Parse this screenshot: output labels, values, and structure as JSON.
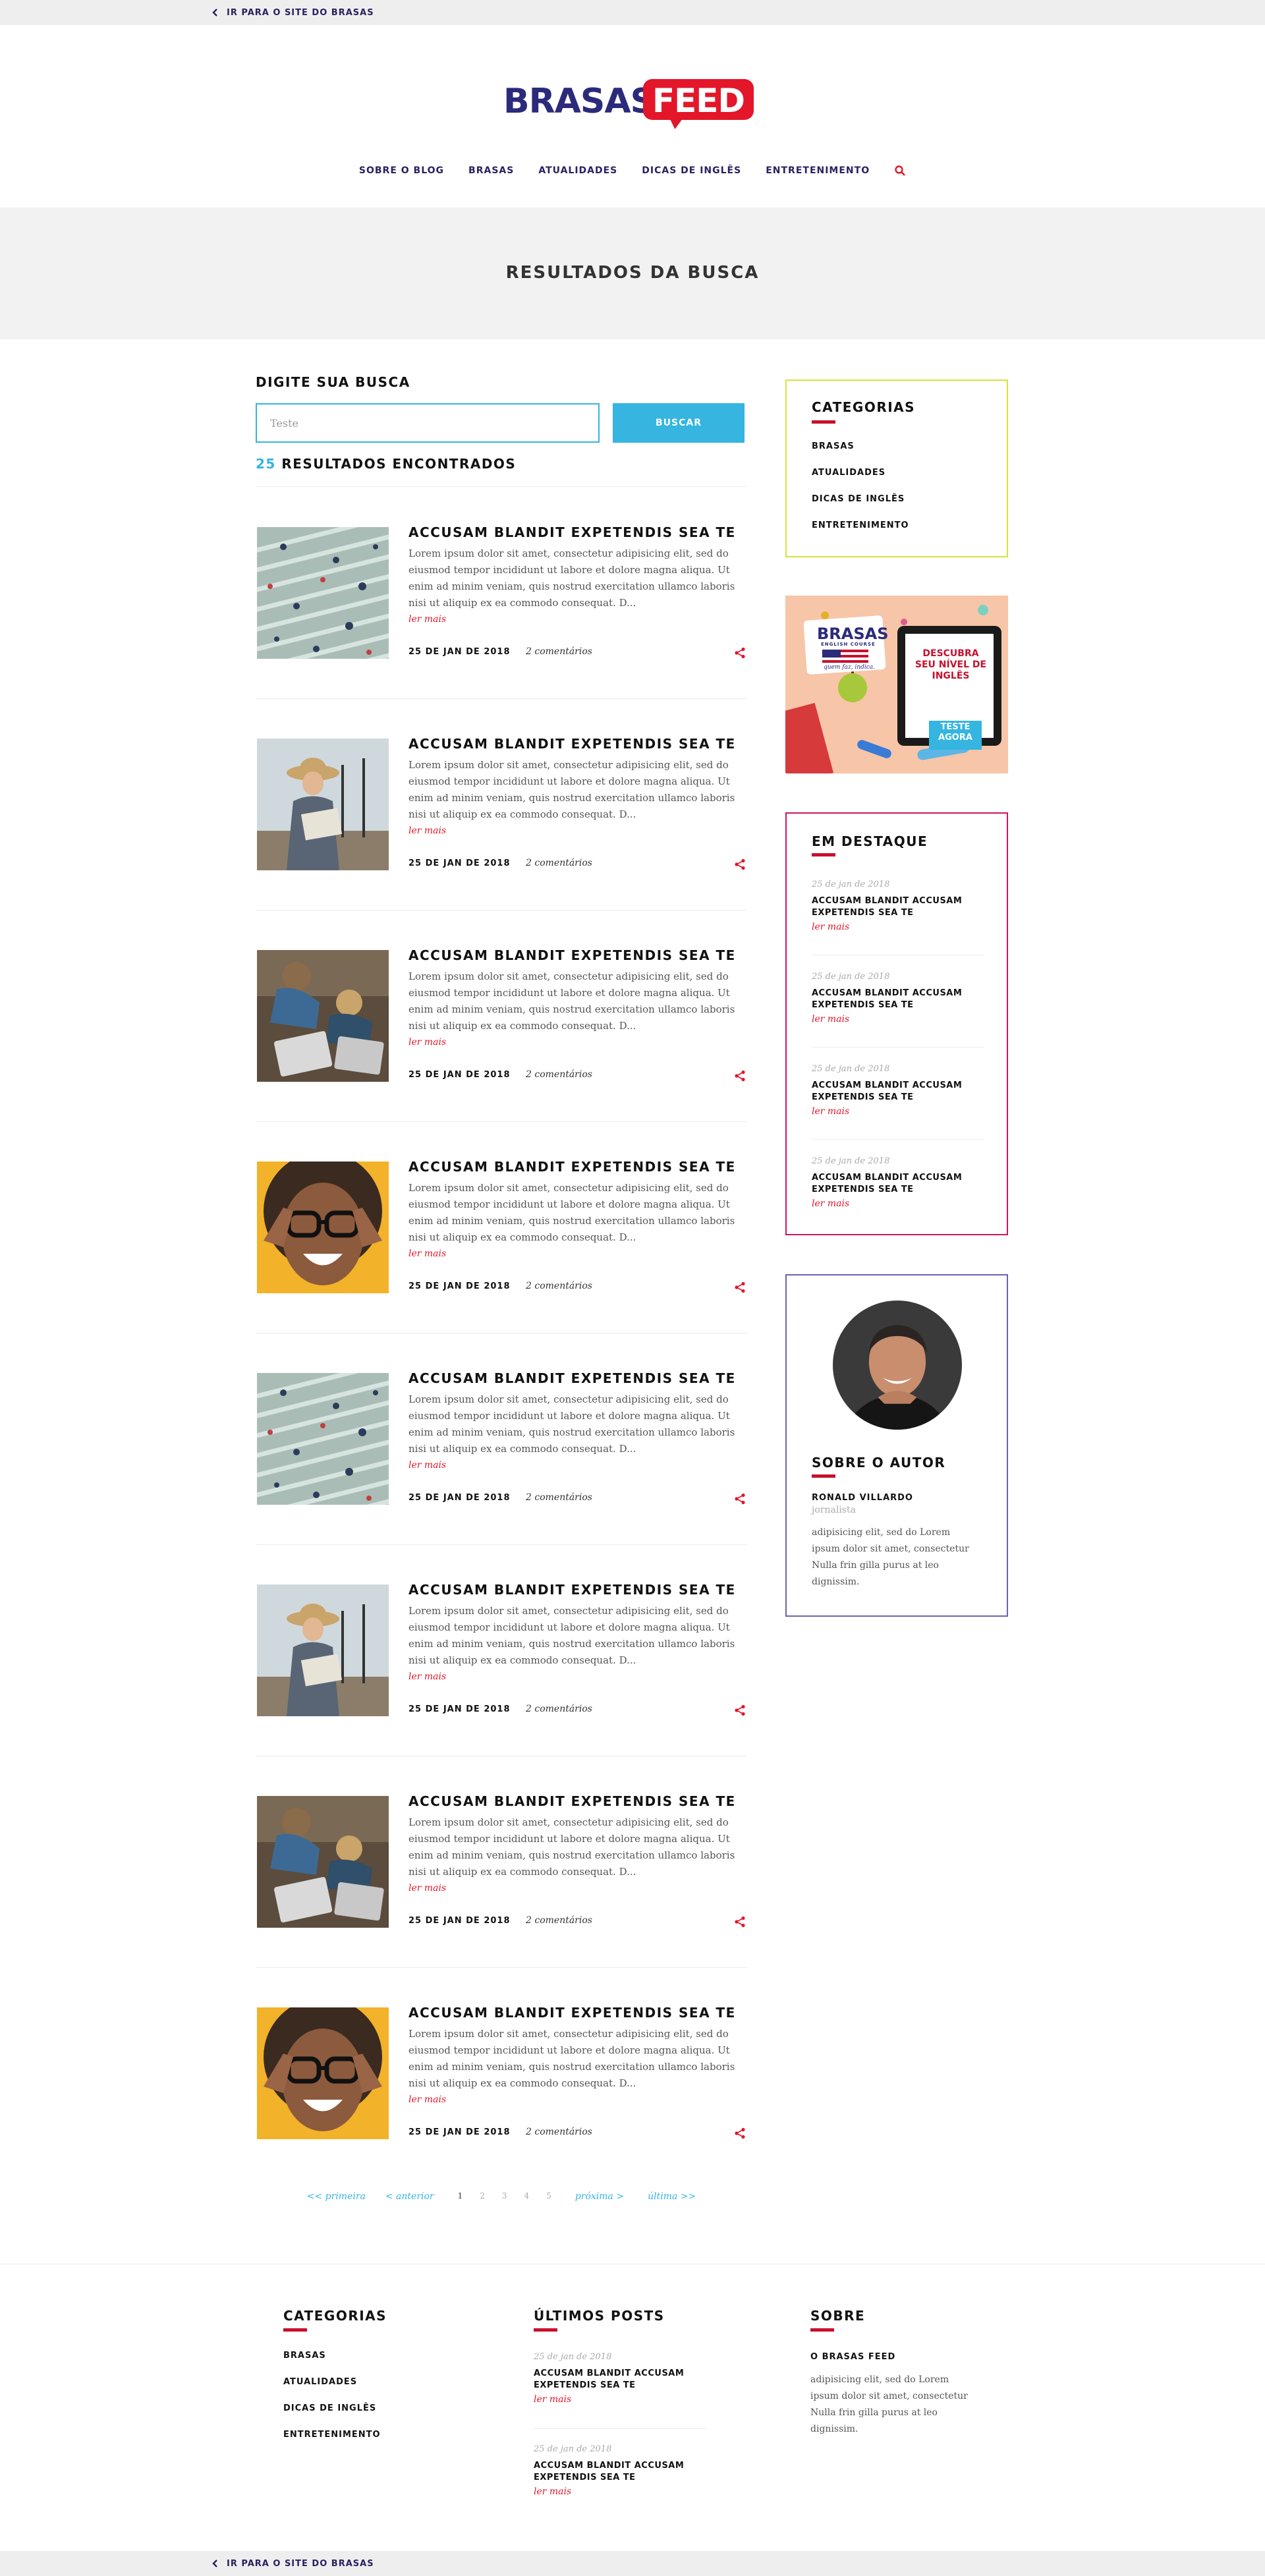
{
  "topbar": {
    "back_label": "IR PARA O SITE DO BRASAS"
  },
  "logo": {
    "left": "BRASAS",
    "right": "FEED"
  },
  "nav": {
    "items": [
      "SOBRE O BLOG",
      "BRASAS",
      "ATUALIDADES",
      "DICAS DE INGLÊS",
      "ENTRETENIMENTO"
    ],
    "search_icon": "search-icon"
  },
  "page_title": "RESULTADOS DA BUSCA",
  "search": {
    "label": "DIGITE SUA BUSCA",
    "value": "Teste",
    "button": "BUSCAR",
    "results_count": "25",
    "results_label": "RESULTADOS ENCONTRADOS"
  },
  "articles": [
    {
      "title": "ACCUSAM BLANDIT EXPETENDIS SEA TE",
      "excerpt": "Lorem ipsum dolor sit amet, consectetur adipisicing elit, sed do eiusmod tempor incididunt ut labore et dolore magna aliqua. Ut enim ad minim veniam, quis nostrud exercitation ullamco laboris nisi ut aliquip ex ea commodo consequat. D...",
      "more": "ler mais",
      "date": "25 DE JAN DE 2018",
      "comments": "2 comentários",
      "image": "crosswalk"
    },
    {
      "title": "ACCUSAM BLANDIT EXPETENDIS SEA TE",
      "excerpt": "Lorem ipsum dolor sit amet, consectetur adipisicing elit, sed do eiusmod tempor incididunt ut labore et dolore magna aliqua. Ut enim ad minim veniam, quis nostrud exercitation ullamco laboris nisi ut aliquip ex ea commodo consequat. D...",
      "more": "ler mais",
      "date": "25 DE JAN DE 2018",
      "comments": "2 comentários",
      "image": "reader"
    },
    {
      "title": "ACCUSAM BLANDIT EXPETENDIS SEA TE",
      "excerpt": "Lorem ipsum dolor sit amet, consectetur adipisicing elit, sed do eiusmod tempor incididunt ut labore et dolore magna aliqua. Ut enim ad minim veniam, quis nostrud exercitation ullamco laboris nisi ut aliquip ex ea commodo consequat. D...",
      "more": "ler mais",
      "date": "25 DE JAN DE 2018",
      "comments": "2 comentários",
      "image": "laptops"
    },
    {
      "title": "ACCUSAM BLANDIT EXPETENDIS SEA TE",
      "excerpt": "Lorem ipsum dolor sit amet, consectetur adipisicing elit, sed do eiusmod tempor incididunt ut labore et dolore magna aliqua. Ut enim ad minim veniam, quis nostrud exercitation ullamco laboris nisi ut aliquip ex ea commodo consequat. D...",
      "more": "ler mais",
      "date": "25 DE JAN DE 2018",
      "comments": "2 comentários",
      "image": "glasses"
    },
    {
      "title": "ACCUSAM BLANDIT EXPETENDIS SEA TE",
      "excerpt": "Lorem ipsum dolor sit amet, consectetur adipisicing elit, sed do eiusmod tempor incididunt ut labore et dolore magna aliqua. Ut enim ad minim veniam, quis nostrud exercitation ullamco laboris nisi ut aliquip ex ea commodo consequat. D...",
      "more": "ler mais",
      "date": "25 DE JAN DE 2018",
      "comments": "2 comentários",
      "image": "crosswalk"
    },
    {
      "title": "ACCUSAM BLANDIT EXPETENDIS SEA TE",
      "excerpt": "Lorem ipsum dolor sit amet, consectetur adipisicing elit, sed do eiusmod tempor incididunt ut labore et dolore magna aliqua. Ut enim ad minim veniam, quis nostrud exercitation ullamco laboris nisi ut aliquip ex ea commodo consequat. D...",
      "more": "ler mais",
      "date": "25 DE JAN DE 2018",
      "comments": "2 comentários",
      "image": "reader"
    },
    {
      "title": "ACCUSAM BLANDIT EXPETENDIS SEA TE",
      "excerpt": "Lorem ipsum dolor sit amet, consectetur adipisicing elit, sed do eiusmod tempor incididunt ut labore et dolore magna aliqua. Ut enim ad minim veniam, quis nostrud exercitation ullamco laboris nisi ut aliquip ex ea commodo consequat. D...",
      "more": "ler mais",
      "date": "25 DE JAN DE 2018",
      "comments": "2 comentários",
      "image": "laptops"
    },
    {
      "title": "ACCUSAM BLANDIT EXPETENDIS SEA TE",
      "excerpt": "Lorem ipsum dolor sit amet, consectetur adipisicing elit, sed do eiusmod tempor incididunt ut labore et dolore magna aliqua. Ut enim ad minim veniam, quis nostrud exercitation ullamco laboris nisi ut aliquip ex ea commodo consequat. D...",
      "more": "ler mais",
      "date": "25 DE JAN DE 2018",
      "comments": "2 comentários",
      "image": "glasses"
    }
  ],
  "pagination": {
    "first": "<< primeira",
    "prev": "< anterior",
    "pages": [
      "1",
      "2",
      "3",
      "4",
      "5"
    ],
    "current": "1",
    "next": "próxima >",
    "last": "última >>"
  },
  "sidebar": {
    "categories": {
      "title": "CATEGORIAS",
      "items": [
        "BRASAS",
        "ATUALIDADES",
        "DICAS DE INGLÊS",
        "ENTRETENIMENTO"
      ],
      "border_color": "#d9e23a"
    },
    "ad": {
      "brand": "BRASAS",
      "brand_sub": "ENGLISH COURSE",
      "slogan": "quem faz, indica.",
      "headline": "DESCUBRA SEU NÍVEL DE INGLÊS",
      "cta": "TESTE AGORA"
    },
    "featured": {
      "title": "EM DESTAQUE",
      "border_color": "#c8175d",
      "items": [
        {
          "date": "25 de jan de 2018",
          "title": "ACCUSAM BLANDIT ACCUSAM EXPETENDIS SEA TE",
          "more": "ler mais"
        },
        {
          "date": "25 de jan de 2018",
          "title": "ACCUSAM BLANDIT ACCUSAM EXPETENDIS SEA TE",
          "more": "ler mais"
        },
        {
          "date": "25 de jan de 2018",
          "title": "ACCUSAM BLANDIT ACCUSAM EXPETENDIS SEA TE",
          "more": "ler mais"
        },
        {
          "date": "25 de jan de 2018",
          "title": "ACCUSAM BLANDIT ACCUSAM EXPETENDIS SEA TE",
          "more": "ler mais"
        }
      ]
    },
    "author": {
      "title": "SOBRE O AUTOR",
      "name": "RONALD VILLARDO",
      "role": "jornalista",
      "bio": "adipisicing elit, sed do Lorem ipsum dolor sit amet, consectetur Nulla frin gilla purus at leo dignissim.",
      "border_color": "#6b62b5"
    }
  },
  "footer": {
    "categories": {
      "title": "CATEGORIAS",
      "items": [
        "BRASAS",
        "ATUALIDADES",
        "DICAS DE INGLÊS",
        "ENTRETENIMENTO"
      ]
    },
    "latest": {
      "title": "ÚLTIMOS POSTS",
      "items": [
        {
          "date": "25 de jan de 2018",
          "title": "ACCUSAM BLANDIT ACCUSAM EXPETENDIS SEA TE",
          "more": "ler mais"
        },
        {
          "date": "25 de jan de 2018",
          "title": "ACCUSAM BLANDIT ACCUSAM EXPETENDIS SEA TE",
          "more": "ler mais"
        }
      ]
    },
    "about": {
      "title": "SOBRE",
      "name": "O BRASAS FEED",
      "text": "adipisicing elit, sed do Lorem ipsum dolor sit amet, consectetur Nulla frin gilla purus at leo dignissim."
    },
    "back_label": "IR PARA O SITE DO BRASAS"
  },
  "colors": {
    "accent_blue": "#35b5e0",
    "accent_red": "#e3162a",
    "brand_navy": "#2c2a7a"
  }
}
